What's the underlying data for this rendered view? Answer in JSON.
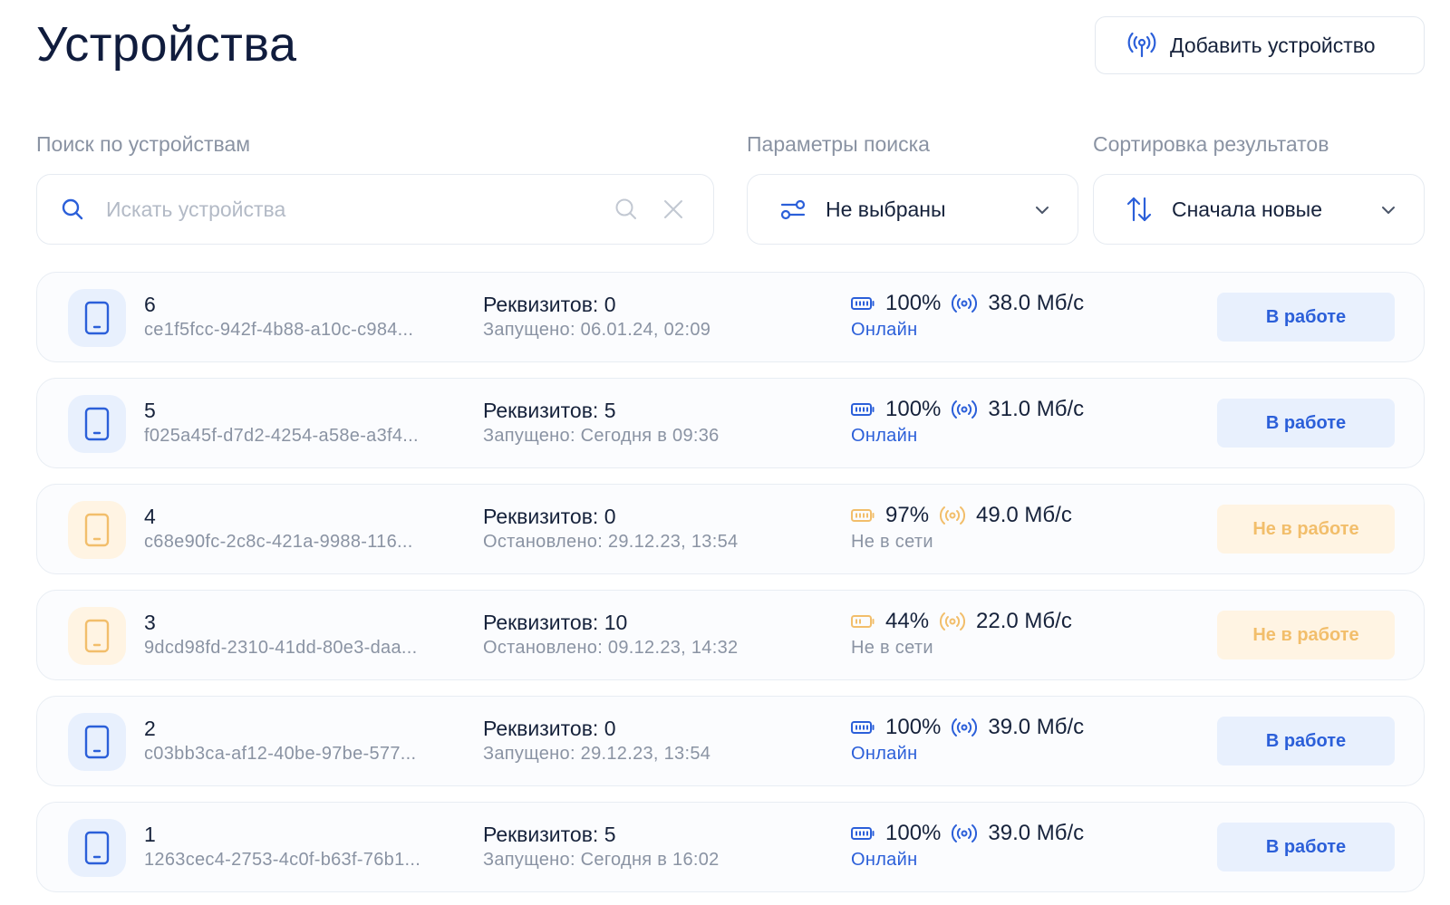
{
  "page": {
    "title": "Устройства"
  },
  "add_device": {
    "label": "Добавить устройство",
    "icon": "broadcast-icon"
  },
  "search": {
    "label": "Поиск по устройствам",
    "placeholder": "Искать устройства",
    "value": ""
  },
  "filters": {
    "label": "Параметры поиска",
    "value": "Не выбраны",
    "icon": "sliders-icon"
  },
  "sorting": {
    "label": "Сортировка результатов",
    "value": "Сначала новые",
    "icon": "sort-arrows-icon"
  },
  "colors": {
    "active_accent": "#2b5fd9",
    "active_bg": "#e8f0fd",
    "inactive_accent": "#f2be6b",
    "inactive_bg": "#fff4e3",
    "text_primary": "#16223b",
    "text_secondary": "#8a93a3"
  },
  "devices": [
    {
      "number": "6",
      "id": "ce1f5fcc-942f-4b88-a10c-c984...",
      "requisites": "Реквизитов: 0",
      "launched": "Запущено: 06.01.24, 02:09",
      "battery": "100%",
      "speed": "38.0 Мб/с",
      "connection": "Онлайн",
      "status": "В работе",
      "active": true
    },
    {
      "number": "5",
      "id": "f025a45f-d7d2-4254-a58e-a3f4...",
      "requisites": "Реквизитов: 5",
      "launched": "Запущено: Сегодня в 09:36",
      "battery": "100%",
      "speed": "31.0 Мб/с",
      "connection": "Онлайн",
      "status": "В работе",
      "active": true
    },
    {
      "number": "4",
      "id": "c68e90fc-2c8c-421a-9988-116...",
      "requisites": "Реквизитов: 0",
      "launched": "Остановлено: 29.12.23, 13:54",
      "battery": "97%",
      "speed": "49.0 Мб/с",
      "connection": "Не в сети",
      "status": "Не в работе",
      "active": false
    },
    {
      "number": "3",
      "id": "9dcd98fd-2310-41dd-80e3-daa...",
      "requisites": "Реквизитов: 10",
      "launched": "Остановлено: 09.12.23, 14:32",
      "battery": "44%",
      "speed": "22.0 Мб/с",
      "connection": "Не в сети",
      "status": "Не в работе",
      "active": false
    },
    {
      "number": "2",
      "id": "c03bb3ca-af12-40be-97be-577...",
      "requisites": "Реквизитов: 0",
      "launched": "Запущено: 29.12.23, 13:54",
      "battery": "100%",
      "speed": "39.0 Мб/с",
      "connection": "Онлайн",
      "status": "В работе",
      "active": true
    },
    {
      "number": "1",
      "id": "1263cec4-2753-4c0f-b63f-76b1...",
      "requisites": "Реквизитов: 5",
      "launched": "Запущено: Сегодня в 16:02",
      "battery": "100%",
      "speed": "39.0 Мб/с",
      "connection": "Онлайн",
      "status": "В работе",
      "active": true
    }
  ]
}
